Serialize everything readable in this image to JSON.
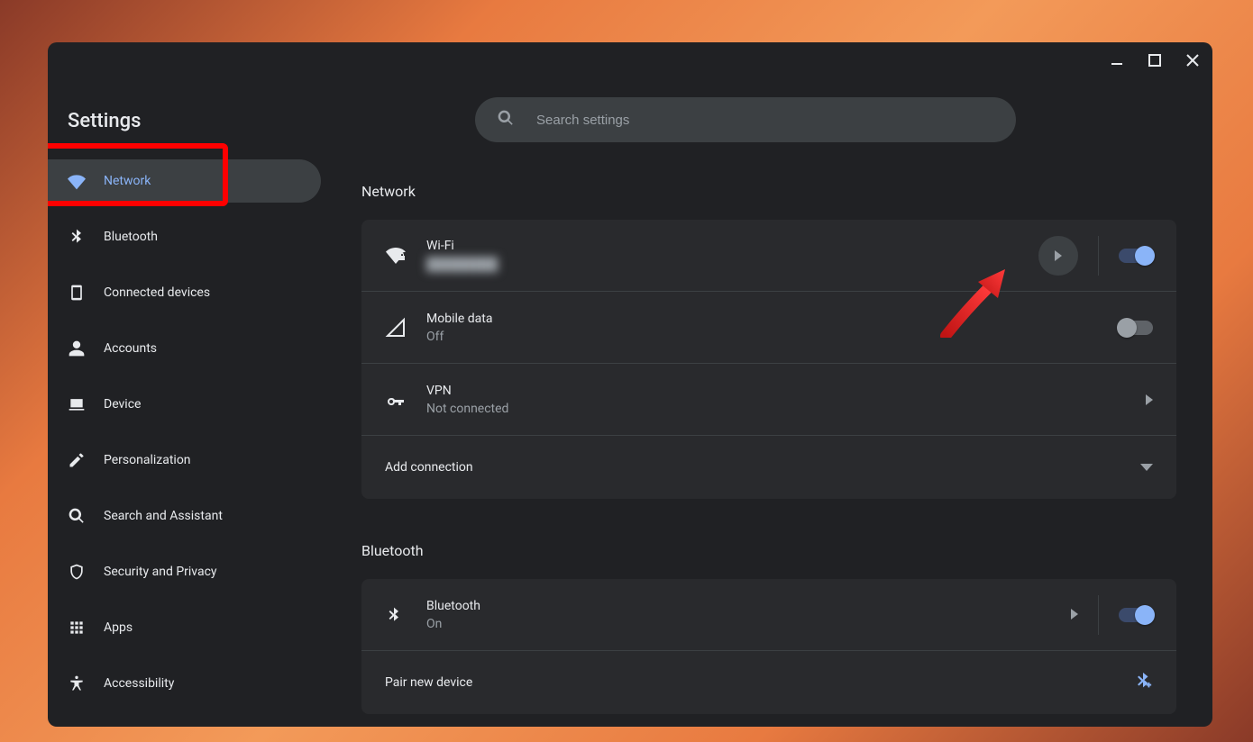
{
  "app_title": "Settings",
  "search": {
    "placeholder": "Search settings"
  },
  "sidebar": {
    "items": [
      {
        "label": "Network"
      },
      {
        "label": "Bluetooth"
      },
      {
        "label": "Connected devices"
      },
      {
        "label": "Accounts"
      },
      {
        "label": "Device"
      },
      {
        "label": "Personalization"
      },
      {
        "label": "Search and Assistant"
      },
      {
        "label": "Security and Privacy"
      },
      {
        "label": "Apps"
      },
      {
        "label": "Accessibility"
      }
    ]
  },
  "sections": {
    "network": {
      "title": "Network",
      "wifi": {
        "label": "Wi-Fi",
        "ssid": "████████",
        "enabled": true
      },
      "mobile": {
        "label": "Mobile data",
        "status": "Off",
        "enabled": false
      },
      "vpn": {
        "label": "VPN",
        "status": "Not connected"
      },
      "add": {
        "label": "Add connection"
      }
    },
    "bluetooth": {
      "title": "Bluetooth",
      "bt": {
        "label": "Bluetooth",
        "status": "On",
        "enabled": true
      },
      "pair": {
        "label": "Pair new device"
      }
    }
  }
}
